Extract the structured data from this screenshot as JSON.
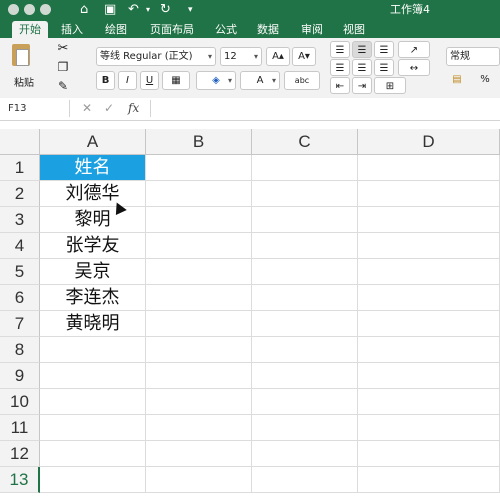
{
  "window": {
    "title": "工作簿4"
  },
  "quick_access": {
    "home_icon": "home-icon",
    "save_icon": "save-icon",
    "undo_icon": "undo-icon",
    "redo_icon": "redo-icon",
    "customize_icon": "customize-icon"
  },
  "tabs": [
    {
      "label": "开始",
      "active": true
    },
    {
      "label": "插入",
      "active": false
    },
    {
      "label": "绘图",
      "active": false
    },
    {
      "label": "页面布局",
      "active": false
    },
    {
      "label": "公式",
      "active": false
    },
    {
      "label": "数据",
      "active": false
    },
    {
      "label": "审阅",
      "active": false
    },
    {
      "label": "视图",
      "active": false
    }
  ],
  "ribbon": {
    "paste_label": "粘贴",
    "font_name": "等线 Regular (正文)",
    "font_size": "12",
    "grow_font": "A▴",
    "shrink_font": "A▾",
    "bold": "B",
    "italic": "I",
    "underline": "U",
    "font_color": "A",
    "phonetic": "abc",
    "number_format": "常规"
  },
  "formula_bar": {
    "name_box": "F13",
    "fx_label": "fx",
    "value": ""
  },
  "sheet": {
    "columns": [
      "A",
      "B",
      "C",
      "D"
    ],
    "rows": [
      "1",
      "2",
      "3",
      "4",
      "5",
      "6",
      "7",
      "8",
      "9",
      "10",
      "11",
      "12",
      "13"
    ],
    "active_row": "13",
    "cells_A": [
      "姓名",
      "刘德华",
      "黎明",
      "张学友",
      "吴京",
      "李连杰",
      "黄晓明",
      "",
      "",
      "",
      "",
      "",
      ""
    ],
    "header_fill": "#1ba1e2"
  },
  "colors": {
    "accent": "#207346",
    "header_fill": "#1ba1e2"
  }
}
